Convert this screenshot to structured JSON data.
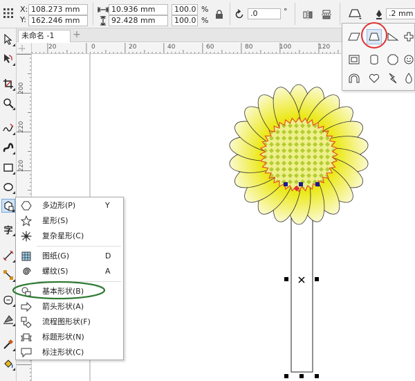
{
  "propbar": {
    "x_label": "X:",
    "x_value": "108.273 mm",
    "y_label": "Y:",
    "y_value": "162.246 mm",
    "width_value": "10.936 mm",
    "height_value": "92.428 mm",
    "scale_x_value": "100.0",
    "scale_y_value": "100.0",
    "percent_symbol": "%",
    "angle_value": ".0",
    "degree_symbol": "°",
    "outline_width_value": ".2 mm"
  },
  "document_tab": {
    "title": "未命名 -1",
    "add_symbol": "+"
  },
  "ruler": {
    "horizontal_labels": [
      "20",
      "0",
      "20",
      "40",
      "60",
      "80",
      "100",
      "120"
    ],
    "vertical_labels": [
      "200",
      "220",
      "220"
    ]
  },
  "context_menu": {
    "items": [
      {
        "label": "多边形(P)",
        "shortcut": "Y",
        "icon": "polygon-icon"
      },
      {
        "label": "星形(S)",
        "shortcut": "",
        "icon": "star-icon"
      },
      {
        "label": "复杂星形(C)",
        "shortcut": "",
        "icon": "complex-star-icon"
      },
      {
        "label": "图纸(G)",
        "shortcut": "D",
        "icon": "graph-paper-icon"
      },
      {
        "label": "螺纹(S)",
        "shortcut": "A",
        "icon": "spiral-icon"
      },
      {
        "label": "基本形状(B)",
        "shortcut": "",
        "icon": "basic-shapes-icon"
      },
      {
        "label": "箭头形状(A)",
        "shortcut": "",
        "icon": "arrow-shapes-icon"
      },
      {
        "label": "流程图形状(F)",
        "shortcut": "",
        "icon": "flowchart-shapes-icon"
      },
      {
        "label": "标题形状(N)",
        "shortcut": "",
        "icon": "banner-shapes-icon"
      },
      {
        "label": "标注形状(C)",
        "shortcut": "",
        "icon": "callout-shapes-icon"
      }
    ]
  },
  "colors": {
    "petal": "#e6e21a",
    "petal_light": "#f8f6b8",
    "center": "#c7d83a",
    "center_zigzag": "#e8521e",
    "annotation_green": "#2f7a33",
    "annotation_red": "#e03030",
    "selection_handle": "#000000",
    "selection_node": "#1a1a8c"
  }
}
